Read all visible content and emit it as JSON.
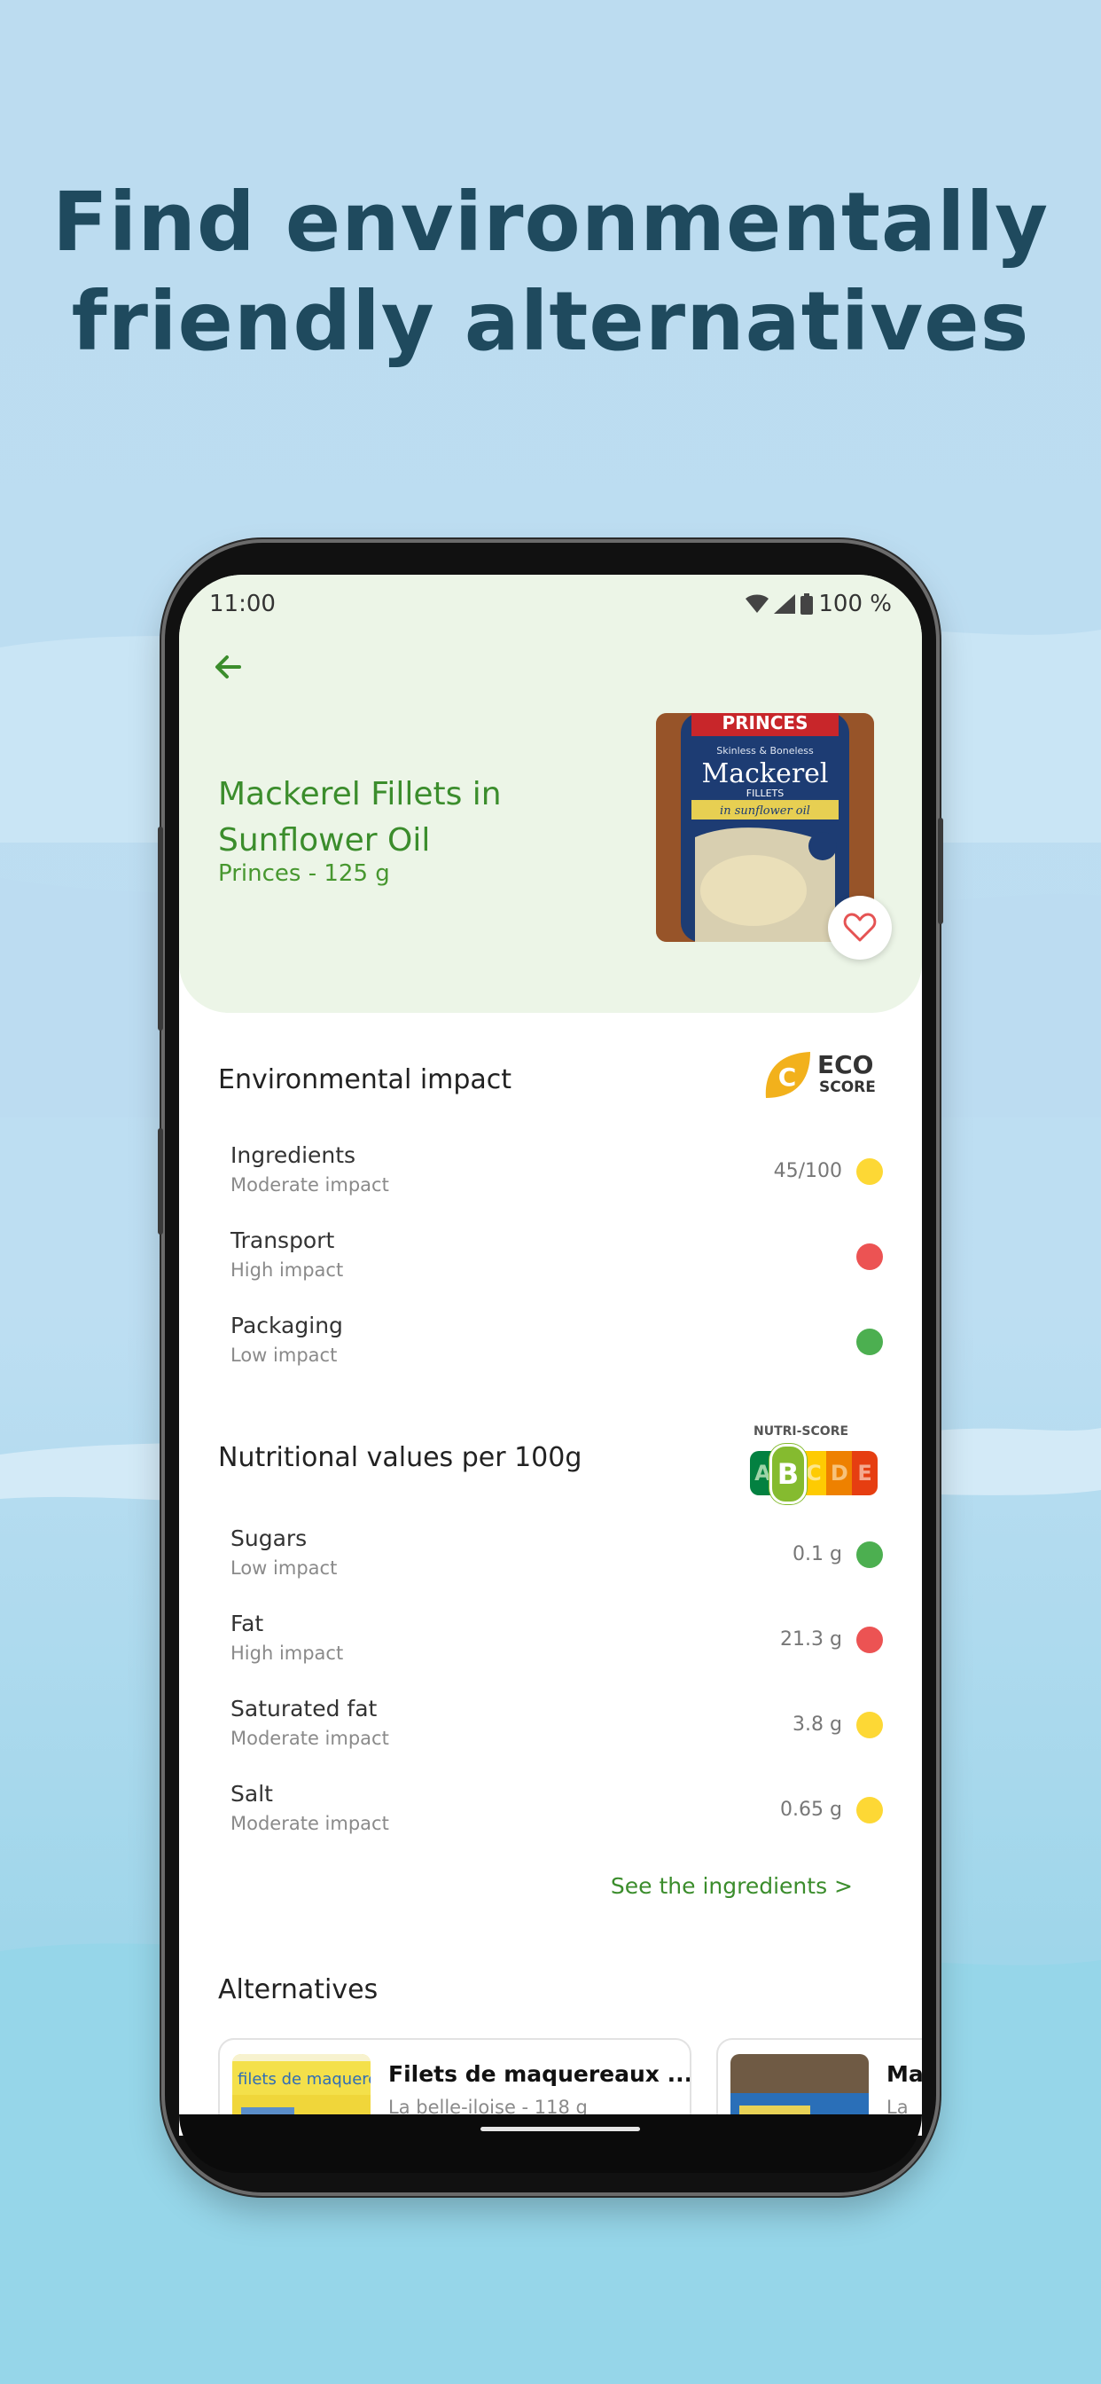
{
  "headline": {
    "line1": "Find environmentally",
    "line2": "friendly alternatives"
  },
  "status_bar": {
    "time": "11:00",
    "battery": "100 %"
  },
  "product": {
    "title_line1": "Mackerel Fillets in",
    "title_line2": "Sunflower Oil",
    "subtitle": "Princes - 125 g",
    "image_brand": "PRINCES",
    "image_tagline": "Skinless & Boneless",
    "image_name": "Mackerel",
    "image_type": "FILLETS",
    "image_oil": "in sunflower oil"
  },
  "environment": {
    "title": "Environmental impact",
    "badge_letter": "C",
    "badge_word1": "ECO",
    "badge_word2": "SCORE",
    "rows": [
      {
        "label": "Ingredients",
        "impact": "Moderate impact",
        "value": "45/100",
        "status": "yellow"
      },
      {
        "label": "Transport",
        "impact": "High impact",
        "value": "",
        "status": "red"
      },
      {
        "label": "Packaging",
        "impact": "Low impact",
        "value": "",
        "status": "green"
      }
    ]
  },
  "nutrition": {
    "title": "Nutritional values per 100g",
    "badge_heading": "NUTRI-SCORE",
    "badge_grades": [
      "A",
      "B",
      "C",
      "D",
      "E"
    ],
    "selected_grade": "B",
    "rows": [
      {
        "label": "Sugars",
        "impact": "Low impact",
        "value": "0.1 g",
        "status": "green"
      },
      {
        "label": "Fat",
        "impact": "High impact",
        "value": "21.3 g",
        "status": "red"
      },
      {
        "label": "Saturated fat",
        "impact": "Moderate impact",
        "value": "3.8 g",
        "status": "yellow"
      },
      {
        "label": "Salt",
        "impact": "Moderate impact",
        "value": "0.65 g",
        "status": "yellow"
      }
    ],
    "link": "See the ingredients >"
  },
  "alternatives": {
    "title": "Alternatives",
    "cards": [
      {
        "title": "Filets de maquereaux ...",
        "subtitle": "La belle-iloise - 118 g",
        "thumb_text": "filets de maquereau"
      },
      {
        "title": "Ma",
        "subtitle": "La"
      }
    ]
  },
  "colors": {
    "accent": "#3b8d2c",
    "background": "#bcdcf0",
    "headline": "#1f4a5e"
  }
}
